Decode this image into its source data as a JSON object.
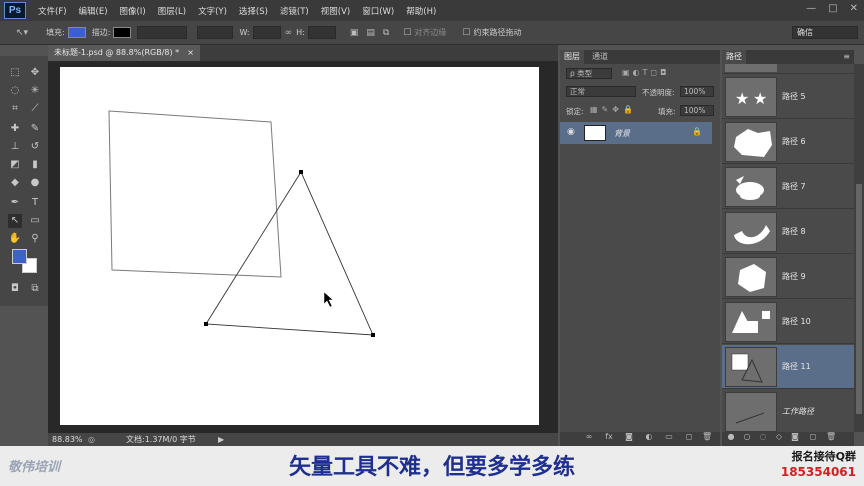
{
  "app": {
    "logo": "Ps",
    "menu": [
      "文件(F)",
      "编辑(E)",
      "图像(I)",
      "图层(L)",
      "文字(Y)",
      "选择(S)",
      "滤镜(T)",
      "视图(V)",
      "窗口(W)",
      "帮助(H)"
    ],
    "window_controls": [
      "—",
      "□",
      "✕"
    ]
  },
  "options_bar": {
    "fill_label": "填充:",
    "stroke_label": "描边:",
    "w_label": "W:",
    "h_label": "H:",
    "align_edges_label": "对齐边缘",
    "constrain_label": "约束路径拖动",
    "workspace": "确信",
    "fill_color": "#3b5fcf",
    "stroke_color": "#000000"
  },
  "document": {
    "tab_title": "未标题-1.psd @ 88.8%(RGB/8) *",
    "close": "×",
    "zoom": "88.83%",
    "doc_info": "文档:1.37M/0 字节"
  },
  "toolbox": {
    "foreground_color": "#3d63c9",
    "background_color": "#ffffff"
  },
  "layers_panel": {
    "tabs": [
      "图层",
      "通道"
    ],
    "filter_label": "ρ 类型",
    "blend_mode": "正常",
    "opacity_label": "不透明度:",
    "opacity": "100%",
    "lock_label": "锁定:",
    "fill_label": "填充:",
    "fill": "100%",
    "layers": [
      {
        "name": "背景",
        "locked": true,
        "visible": true
      }
    ]
  },
  "paths_panel": {
    "title": "路径",
    "paths": [
      "路径 5",
      "路径 6",
      "路径 7",
      "路径 8",
      "路径 9",
      "路径 10",
      "路径 11",
      "工作路径"
    ],
    "selected": "路径 11"
  },
  "banner": {
    "brand": "敬伟培训",
    "caption": "矢量工具不难，但要多学多练",
    "contact_label": "报名接待Q群",
    "contact_number": "185354061"
  }
}
